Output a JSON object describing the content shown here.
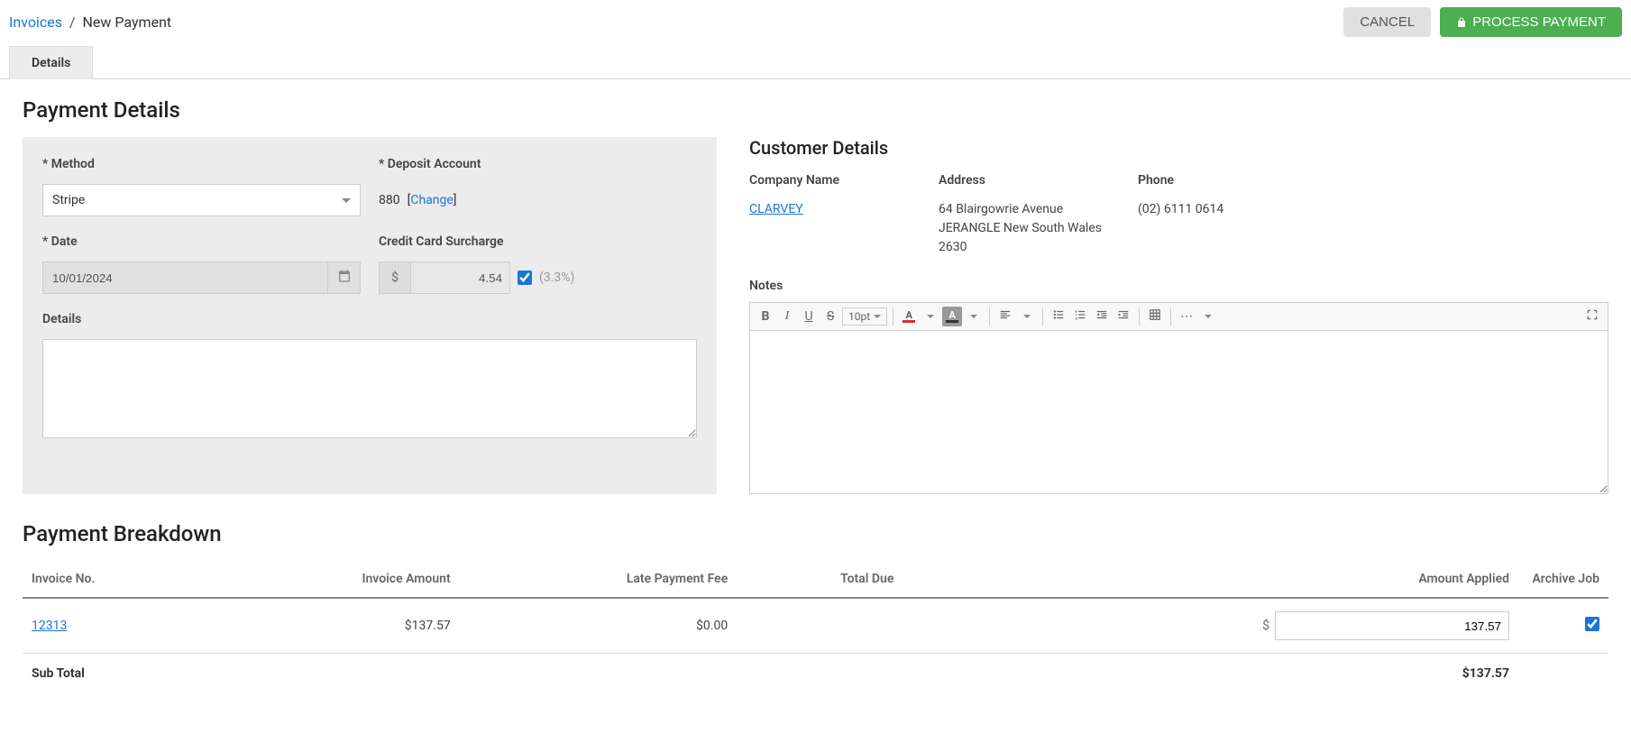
{
  "breadcrumb": {
    "parent": "Invoices",
    "current": "New Payment"
  },
  "actions": {
    "cancel": "CANCEL",
    "process": "PROCESS PAYMENT"
  },
  "tabs": {
    "details": "Details"
  },
  "section_titles": {
    "payment_details": "Payment Details",
    "customer_details": "Customer Details",
    "payment_breakdown": "Payment Breakdown"
  },
  "form": {
    "method_label": "* Method",
    "method_value": "Stripe",
    "deposit_label": "* Deposit Account",
    "deposit_value": "880",
    "deposit_change": "Change",
    "date_label": "* Date",
    "date_value": "10/01/2024",
    "surcharge_label": "Credit Card Surcharge",
    "surcharge_currency": "$",
    "surcharge_value": "4.54",
    "surcharge_pct": "(3.3%)",
    "details_label": "Details"
  },
  "customer": {
    "company_label": "Company Name",
    "company_value": "CLARVEY",
    "address_label": "Address",
    "address_line1": "64 Blairgowrie Avenue",
    "address_line2": "JERANGLE New South Wales",
    "address_line3": "2630",
    "phone_label": "Phone",
    "phone_value": "(02) 6111 0614",
    "notes_label": "Notes"
  },
  "editor": {
    "font_size": "10pt"
  },
  "breakdown": {
    "headers": {
      "invoice_no": "Invoice No.",
      "invoice_amount": "Invoice Amount",
      "late_fee": "Late Payment Fee",
      "total_due": "Total Due",
      "amount_applied": "Amount Applied",
      "archive": "Archive Job"
    },
    "rows": [
      {
        "invoice_no": "12313",
        "invoice_amount": "$137.57",
        "late_fee": "$0.00",
        "total_due": "",
        "amount_applied": "137.57",
        "currency": "$",
        "archive": true
      }
    ],
    "subtotal_label": "Sub Total",
    "subtotal_value": "$137.57"
  }
}
